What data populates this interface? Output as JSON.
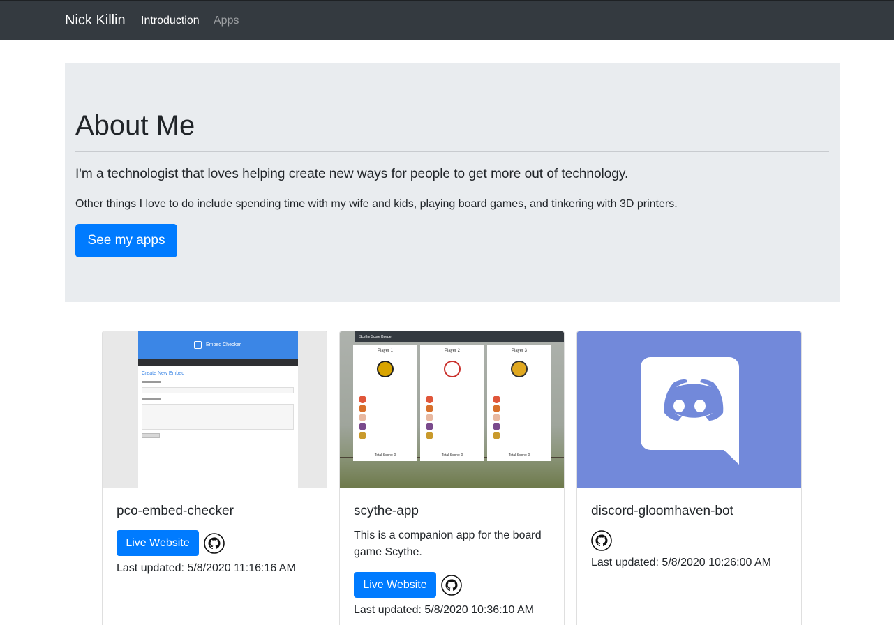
{
  "navbar": {
    "brand": "Nick Killin",
    "links": [
      {
        "label": "Introduction"
      },
      {
        "label": "Apps"
      }
    ]
  },
  "jumbotron": {
    "title": "About Me",
    "lead": "I'm a technologist that loves helping create new ways for people to get more out of technology.",
    "text": "Other things I love to do include spending time with my wife and kids, playing board games, and tinkering with 3D printers.",
    "button_label": "See my apps"
  },
  "cards": [
    {
      "title": "pco-embed-checker",
      "description": "",
      "live_label": "Live Website",
      "updated": "Last updated: 5/8/2020 11:16:16 AM",
      "preview": {
        "header": "Embed Checker",
        "form_title": "Create New Embed"
      }
    },
    {
      "title": "scythe-app",
      "description": "This is a companion app for the board game Scythe.",
      "live_label": "Live Website",
      "updated": "Last updated: 5/8/2020 10:36:10 AM",
      "preview": {
        "header": "Scythe Score Keeper",
        "players": [
          "Player 1",
          "Player 2",
          "Player 3"
        ],
        "total": "Total Score: 0"
      }
    },
    {
      "title": "discord-gloomhaven-bot",
      "description": "",
      "updated": "Last updated: 5/8/2020 10:26:00 AM"
    }
  ],
  "colors": {
    "navbar": "#343a40",
    "primary": "#007bff",
    "jumbotron": "#e9ecef",
    "discord": "#7289da"
  }
}
